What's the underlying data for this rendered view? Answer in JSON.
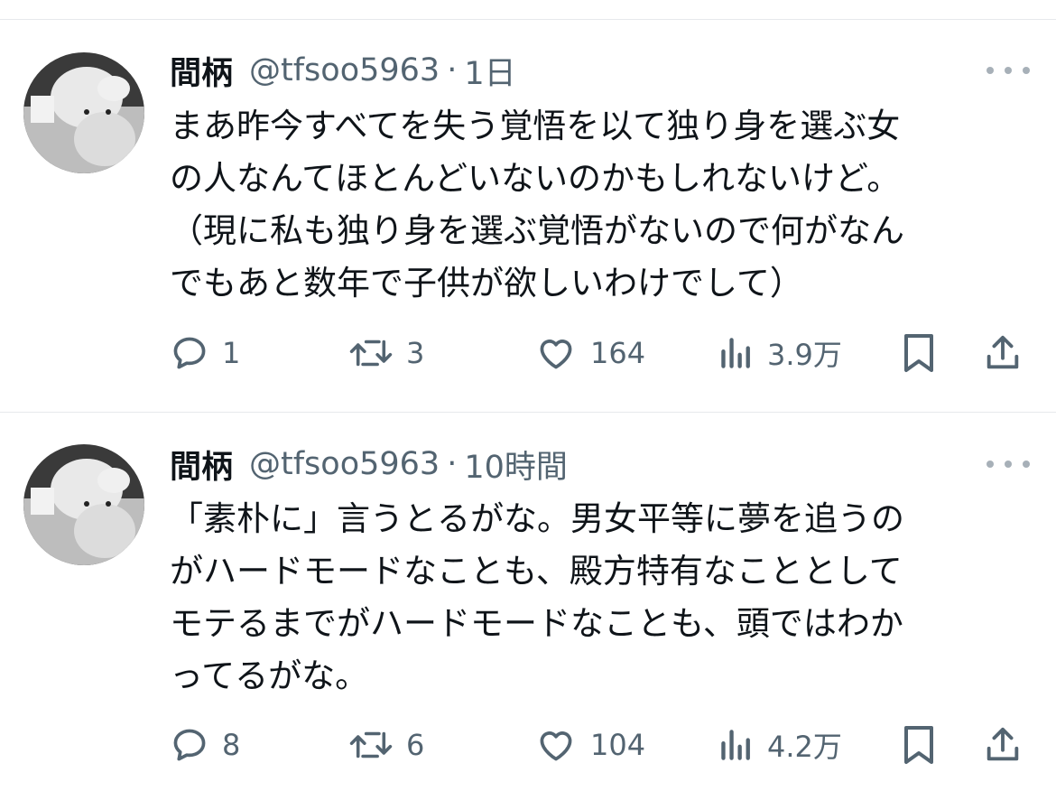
{
  "tweets": [
    {
      "name": "間柄",
      "handle": "@tfsoo5963",
      "separator": "·",
      "time": "1日",
      "lines": [
        "まあ昨今すべてを失う覚悟を以て独り身を選ぶ女",
        "の人なんてほとんどいないのかもしれないけど。",
        "（現に私も独り身を選ぶ覚悟がないので何がなん",
        "でもあと数年で子供が欲しいわけでして）"
      ],
      "replies": "1",
      "retweets": "3",
      "likes": "164",
      "views": "3.9万"
    },
    {
      "name": "間柄",
      "handle": "@tfsoo5963",
      "separator": "·",
      "time": "10時間",
      "lines": [
        "「素朴に」言うとるがな。男女平等に夢を追うの",
        "がハードモードなことも、殿方特有なこととして",
        "モテるまでがハードモードなことも、頭ではわか",
        "ってるがな。"
      ],
      "replies": "8",
      "retweets": "6",
      "likes": "104",
      "views": "4.2万"
    }
  ],
  "colors": {
    "text": "#0f1419",
    "secondary": "#536471",
    "divider": "#e6e9ec"
  },
  "icons": [
    "reply-icon",
    "retweet-icon",
    "like-icon",
    "views-icon",
    "bookmark-icon",
    "share-icon",
    "more-icon"
  ]
}
